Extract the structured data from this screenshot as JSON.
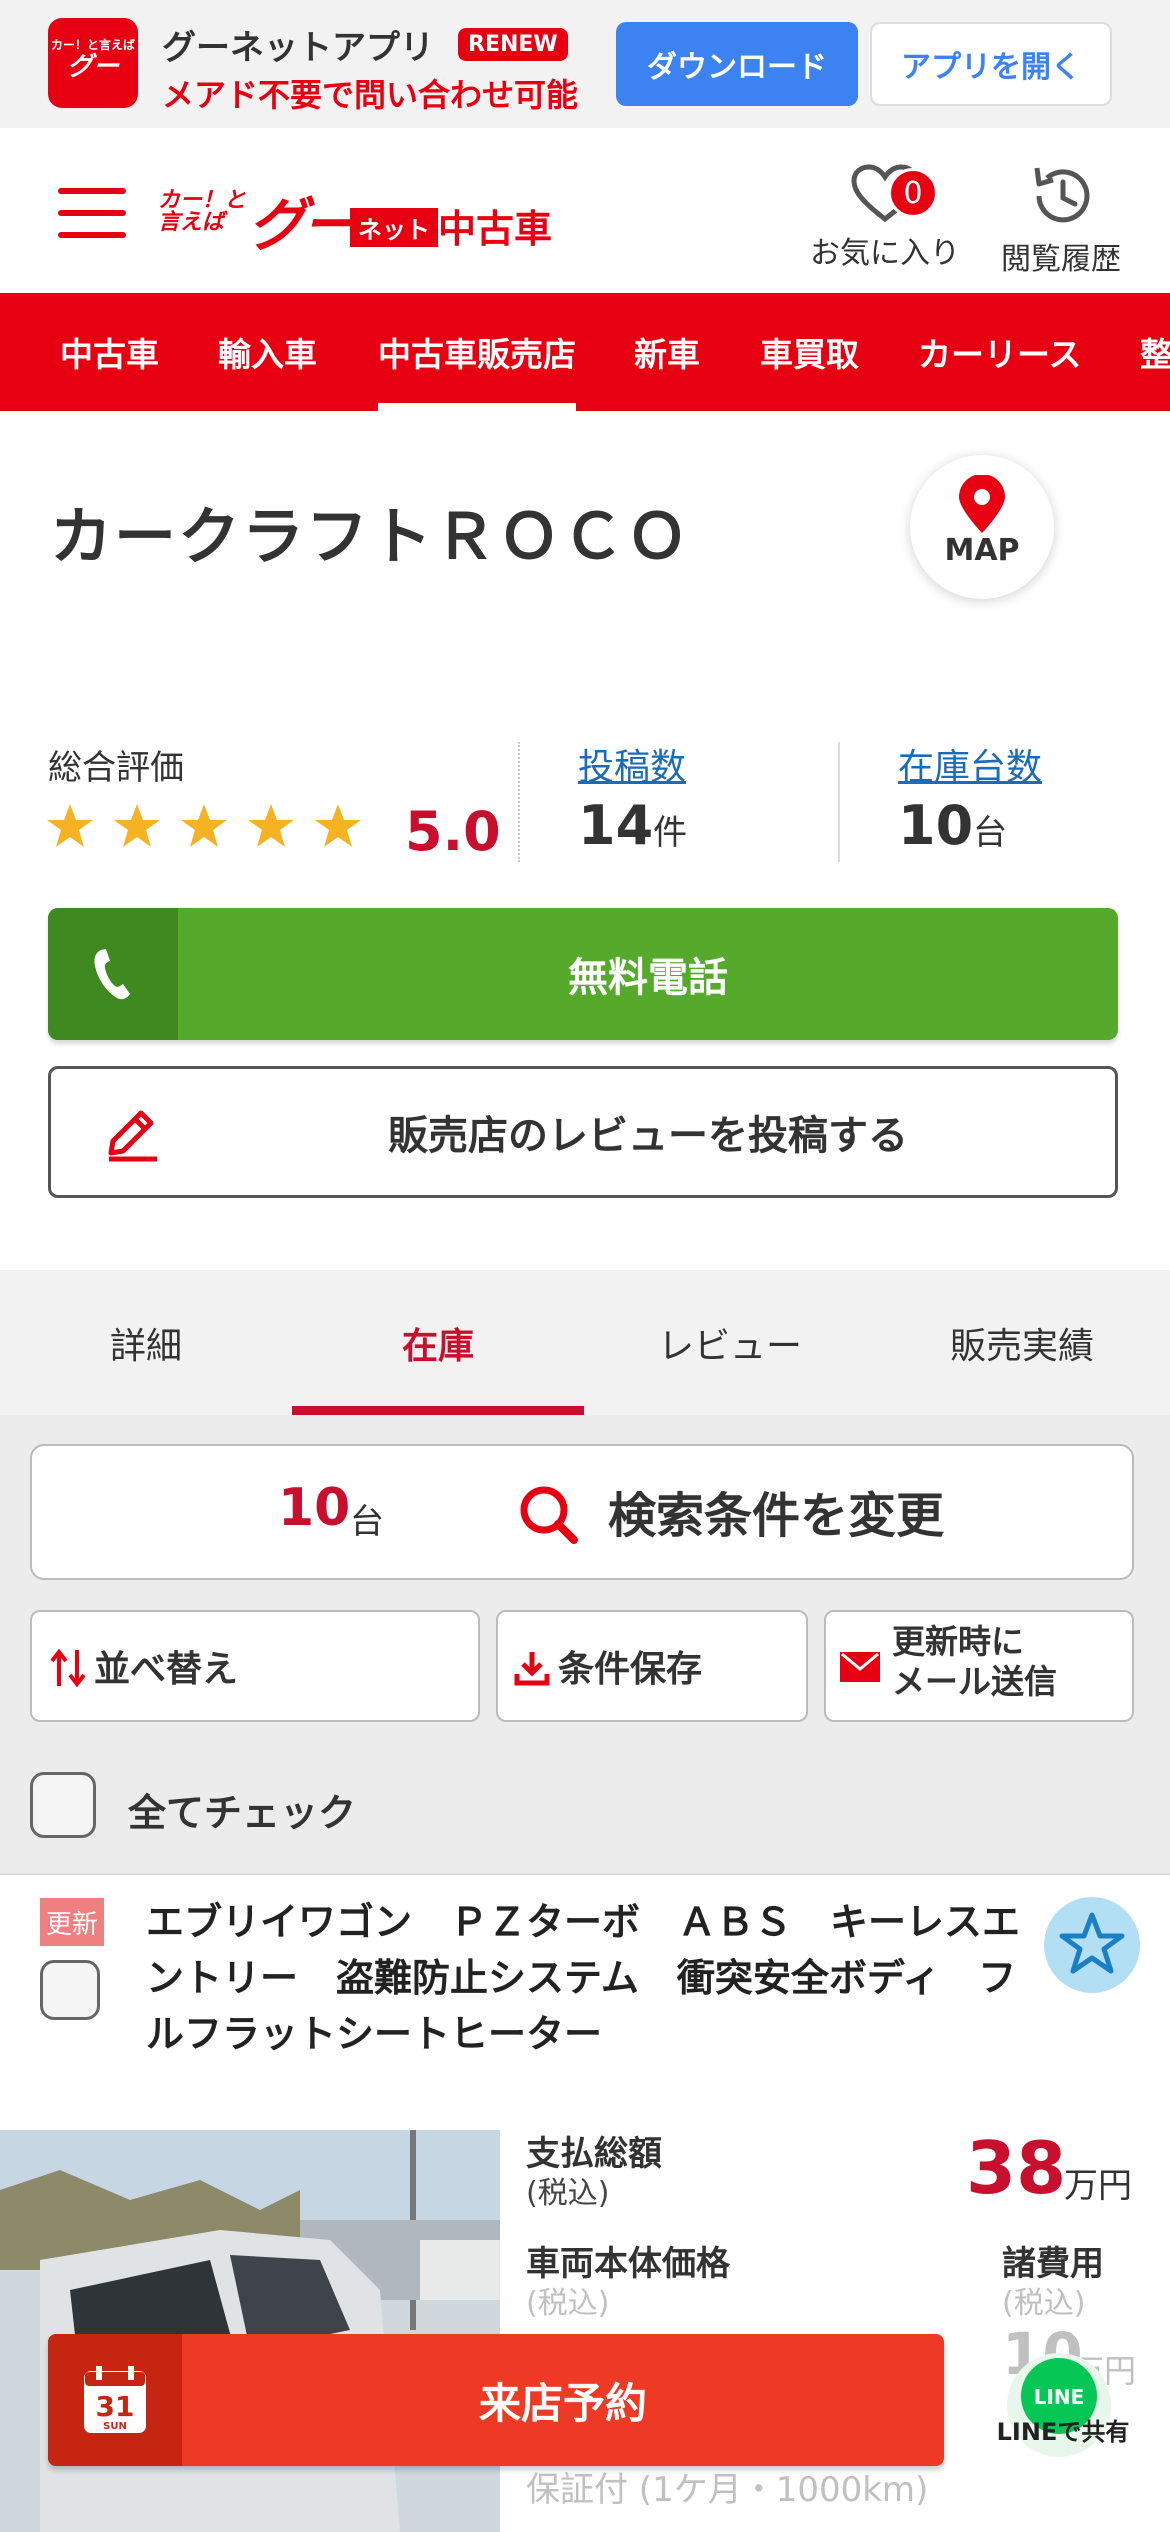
{
  "app_banner": {
    "logo_small": "カー！と言えば",
    "logo_big": "グー",
    "title": "グーネットアプリ",
    "renew_badge": "RENEW",
    "subtitle": "メアド不要で問い合わせ可能",
    "download_label": "ダウンロード",
    "open_label": "アプリを開く"
  },
  "header": {
    "brand_small": "カー！と言えば",
    "brand_goo": "グー",
    "brand_net": "ネット",
    "brand_used": "中古車",
    "favorites_label": "お気に入り",
    "favorites_count": "0",
    "history_label": "閲覧履歴"
  },
  "nav": {
    "items": [
      {
        "label": "中古車"
      },
      {
        "label": "輸入車"
      },
      {
        "label": "中古車販売店",
        "active": true
      },
      {
        "label": "新車"
      },
      {
        "label": "車買取"
      },
      {
        "label": "カーリース"
      },
      {
        "label": "整"
      }
    ]
  },
  "shop": {
    "name": "カークラフトＲＯＣＯ",
    "map_label": "MAP"
  },
  "rating": {
    "label": "総合評価",
    "value": "5.0",
    "stars": 5,
    "posts_label": "投稿数",
    "posts_count": "14",
    "posts_unit": "件",
    "stock_label": "在庫台数",
    "stock_count": "10",
    "stock_unit": "台"
  },
  "actions": {
    "phone_label": "無料電話",
    "review_label": "販売店のレビューを投稿する"
  },
  "tabs": [
    {
      "label": "詳細"
    },
    {
      "label": "在庫",
      "active": true
    },
    {
      "label": "レビュー"
    },
    {
      "label": "販売実績"
    }
  ],
  "search": {
    "count": "10",
    "count_unit": "台",
    "change_label": "検索条件を変更",
    "sort_label": "並べ替え",
    "save_label": "条件保存",
    "mail_label_1": "更新時に",
    "mail_label_2": "メール送信",
    "check_all_label": "全てチェック"
  },
  "listing": {
    "update_badge": "更新",
    "title": "エブリイワゴン　ＰＺターボ　ＡＢＳ　キーレスエントリー　盗難防止システム　衝突安全ボディ　フルフラットシートヒーター",
    "total_label": "支払総額",
    "total_tax": "(税込)",
    "total_price": "38",
    "total_unit": "万円",
    "body_label": "車両本体価格",
    "body_tax": "(税込)",
    "fees_label": "諸費用",
    "fees_tax": "(税込)",
    "fees_value": "10",
    "fees_unit": "万円",
    "warranty": "保証付 (1ケ月・1000km)"
  },
  "bottom": {
    "calendar_day": "31",
    "calendar_dow": "SUN",
    "reserve_label": "来店予約",
    "line_icon_text": "LINE",
    "line_share_label": "LINEで共有"
  },
  "colors": {
    "brand_red": "#e60012",
    "phone_green": "#55aa2b",
    "link_blue": "#1a6bb8",
    "app_blue": "#3c82f0",
    "reserve_red": "#ee3a24",
    "star_yellow": "#f5b324"
  }
}
